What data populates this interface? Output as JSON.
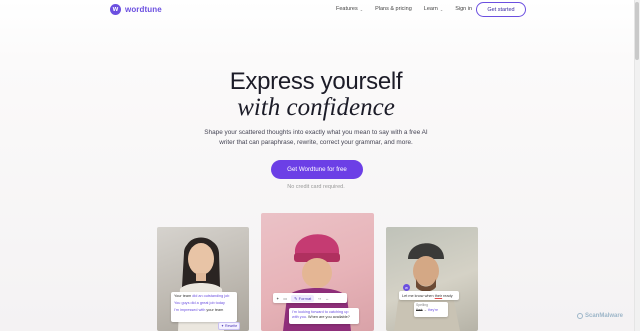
{
  "brand": {
    "logo_glyph": "w",
    "name": "wordtune",
    "accent": "#6b4fe0"
  },
  "nav": {
    "items": [
      {
        "label": "Features",
        "has_dropdown": true
      },
      {
        "label": "Plans & pricing",
        "has_dropdown": false
      },
      {
        "label": "Learn",
        "has_dropdown": true
      },
      {
        "label": "Sign in",
        "has_dropdown": false
      }
    ],
    "cta_label": "Get started"
  },
  "hero": {
    "title": "Express yourself",
    "subtitle": "with confidence",
    "description": "Shape your scattered thoughts into exactly what you mean to say with a free AI writer that can paraphrase, rewrite, correct your grammar, and more.",
    "cta_label": "Get Wordtune for free",
    "note": "No credit card required."
  },
  "card1": {
    "lines": [
      {
        "pre": "Your team ",
        "hl": "did an outstanding job"
      },
      {
        "pre": "",
        "hl": "You guys did a great job today"
      },
      {
        "pre": "",
        "hl": "I'm impressed with ",
        "post": "your team"
      }
    ],
    "rewrite_label": "Rewrite"
  },
  "card2": {
    "toolbar": {
      "format_label": "Format"
    },
    "message": {
      "hl": "I'm looking forward to catching up with you.",
      "post": " When are you available?"
    }
  },
  "card3": {
    "sentence": {
      "pre": "Let me know when ",
      "hl": "their",
      "post": " ready"
    },
    "suggestions": [
      "Spelling",
      "their",
      "they're"
    ],
    "arrow": "→"
  },
  "watermark": "ScanMalware"
}
